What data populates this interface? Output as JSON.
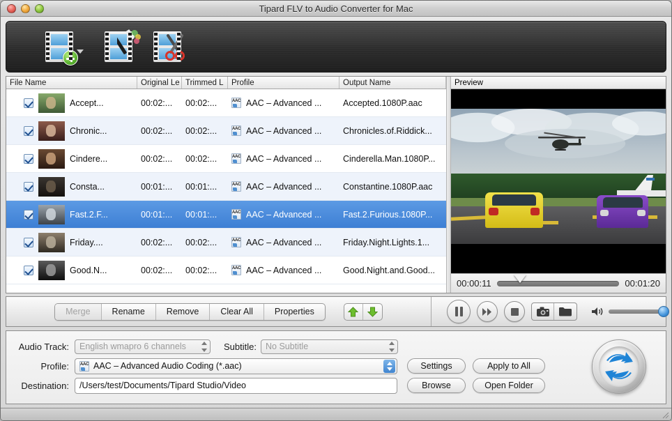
{
  "window": {
    "title": "Tipard FLV to Audio Converter for Mac",
    "controls": {
      "close": "close-button",
      "minimize": "minimize-button",
      "zoom": "zoom-button"
    }
  },
  "toolbar": {
    "items": [
      {
        "name": "add-file",
        "icon": "add-file-icon",
        "has_caret": true
      },
      {
        "name": "edit",
        "icon": "edit-magic-wand-icon",
        "has_caret": false
      },
      {
        "name": "clip",
        "icon": "clip-scissors-icon",
        "has_caret": false
      }
    ]
  },
  "table": {
    "columns": [
      "File Name",
      "Original Le",
      "Trimmed L",
      "Profile",
      "Output Name"
    ],
    "preview_column": "Preview",
    "rows": [
      {
        "checked": true,
        "name": "Accept...",
        "original": "00:02:...",
        "trimmed": "00:02:...",
        "profile": "AAC – Advanced ...",
        "output": "Accepted.1080P.aac",
        "selected": false
      },
      {
        "checked": true,
        "name": "Chronic...",
        "original": "00:02:...",
        "trimmed": "00:02:...",
        "profile": "AAC – Advanced ...",
        "output": "Chronicles.of.Riddick...",
        "selected": false
      },
      {
        "checked": true,
        "name": "Cindere...",
        "original": "00:02:...",
        "trimmed": "00:02:...",
        "profile": "AAC – Advanced ...",
        "output": "Cinderella.Man.1080P...",
        "selected": false
      },
      {
        "checked": true,
        "name": "Consta...",
        "original": "00:01:...",
        "trimmed": "00:01:...",
        "profile": "AAC – Advanced ...",
        "output": "Constantine.1080P.aac",
        "selected": false
      },
      {
        "checked": true,
        "name": "Fast.2.F...",
        "original": "00:01:...",
        "trimmed": "00:01:...",
        "profile": "AAC – Advanced ...",
        "output": "Fast.2.Furious.1080P...",
        "selected": true
      },
      {
        "checked": true,
        "name": "Friday....",
        "original": "00:02:...",
        "trimmed": "00:02:...",
        "profile": "AAC – Advanced ...",
        "output": "Friday.Night.Lights.1...",
        "selected": false
      },
      {
        "checked": true,
        "name": "Good.N...",
        "original": "00:02:...",
        "trimmed": "00:02:...",
        "profile": "AAC – Advanced ...",
        "output": "Good.Night.and.Good...",
        "selected": false
      }
    ]
  },
  "preview": {
    "current_time": "00:00:11",
    "total_time": "00:01:20",
    "progress_percent": 14
  },
  "actions": {
    "buttons": [
      {
        "label": "Merge",
        "disabled": true
      },
      {
        "label": "Rename",
        "disabled": false
      },
      {
        "label": "Remove",
        "disabled": false
      },
      {
        "label": "Clear All",
        "disabled": false
      },
      {
        "label": "Properties",
        "disabled": false
      }
    ],
    "move_up": "move-up-button",
    "move_down": "move-down-button"
  },
  "playback": {
    "pause": "pause-button",
    "forward": "fast-forward-button",
    "stop": "stop-button",
    "snapshot": "snapshot-camera-button",
    "open_folder": "open-snapshot-folder-button",
    "volume_icon": "volume-speaker-icon",
    "volume_percent": 100
  },
  "settings": {
    "audio_track_label": "Audio Track:",
    "audio_track_value": "English wmapro 6 channels",
    "subtitle_label": "Subtitle:",
    "subtitle_value": "No Subtitle",
    "profile_label": "Profile:",
    "profile_value": "AAC – Advanced Audio Coding (*.aac)",
    "destination_label": "Destination:",
    "destination_value": "/Users/test/Documents/Tipard Studio/Video",
    "settings_button": "Settings",
    "apply_all_button": "Apply to All",
    "browse_button": "Browse",
    "open_folder_button": "Open Folder",
    "convert_button": "convert-button"
  },
  "colors": {
    "selection_blue": "#3d7fd4",
    "accent_blue": "#1f84d6",
    "arrow_green": "#6dbe2e"
  }
}
